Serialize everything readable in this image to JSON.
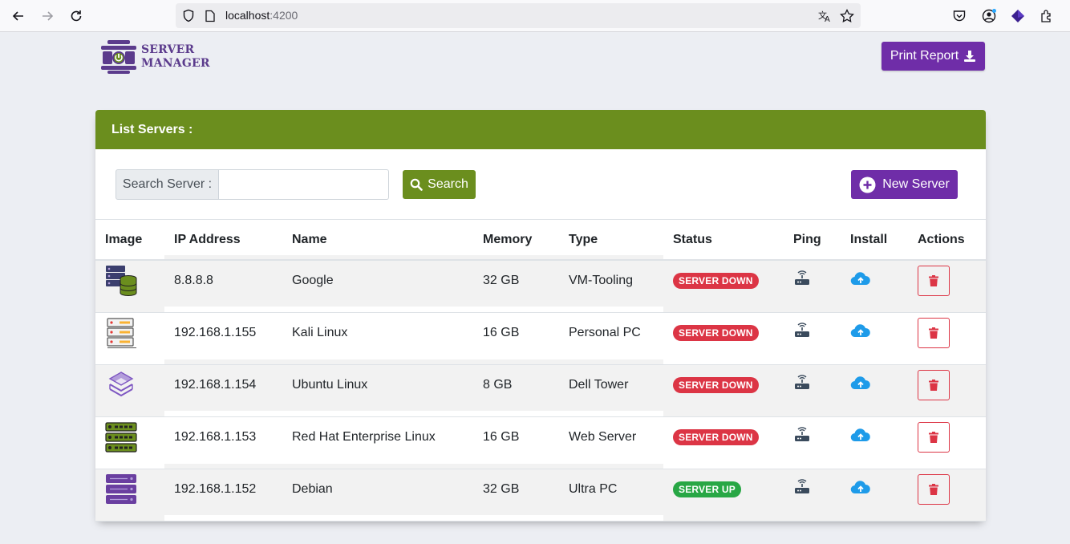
{
  "browser": {
    "url_host": "localhost",
    "url_port": ":4200"
  },
  "app": {
    "logo_line1": "SERVER",
    "logo_line2": "MANAGER",
    "print_label": "Print Report"
  },
  "card": {
    "title": "List Servers :",
    "search_label": "Search Server :",
    "search_value": "",
    "search_button": "Search",
    "new_button": "New Server"
  },
  "table": {
    "headers": [
      "Image",
      "IP Address",
      "Name",
      "Memory",
      "Type",
      "Status",
      "Ping",
      "Install",
      "Actions"
    ],
    "rows": [
      {
        "icon": "database-server-icon",
        "ip": "8.8.8.8",
        "name": "Google",
        "memory": "32 GB",
        "type": "VM-Tooling",
        "status": "SERVER DOWN"
      },
      {
        "icon": "server-rack-icon",
        "ip": "192.168.1.155",
        "name": "Kali Linux",
        "memory": "16 GB",
        "type": "Personal PC",
        "status": "SERVER DOWN"
      },
      {
        "icon": "layers-server-icon",
        "ip": "192.168.1.154",
        "name": "Ubuntu Linux",
        "memory": "8 GB",
        "type": "Dell Tower",
        "status": "SERVER DOWN"
      },
      {
        "icon": "green-server-rack-icon",
        "ip": "192.168.1.153",
        "name": "Red Hat Enterprise Linux",
        "memory": "16 GB",
        "type": "Web Server",
        "status": "SERVER DOWN"
      },
      {
        "icon": "purple-server-rack-icon",
        "ip": "192.168.1.152",
        "name": "Debian",
        "memory": "32 GB",
        "type": "Ultra PC",
        "status": "SERVER UP"
      }
    ]
  },
  "colors": {
    "brand_purple": "#6f2da8",
    "brand_green": "#6b8e1e",
    "danger": "#dc3545",
    "success": "#28a745",
    "install_blue": "#1e9be9"
  }
}
